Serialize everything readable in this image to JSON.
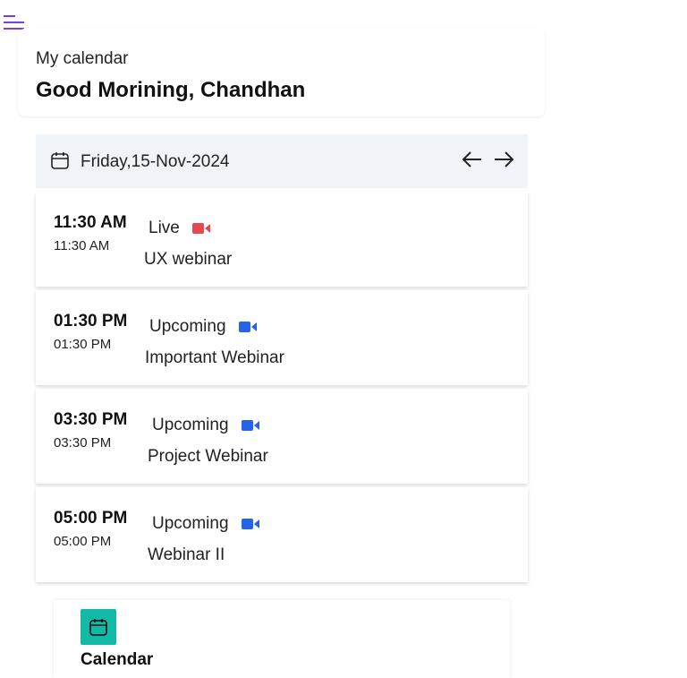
{
  "header": {
    "subtitle": "My calendar",
    "greeting": "Good Morining, Chandhan"
  },
  "schedule": {
    "date": "Friday,15-Nov-2024",
    "events": [
      {
        "time": "11:30 AM",
        "time_sub": "11:30 AM",
        "status": "Live",
        "title": "UX webinar",
        "video_color": "#e5484d"
      },
      {
        "time": "01:30 PM",
        "time_sub": "01:30 PM",
        "status": "Upcoming",
        "title": "Important Webinar",
        "video_color": "#2563eb"
      },
      {
        "time": "03:30 PM",
        "time_sub": "03:30 PM",
        "status": "Upcoming",
        "title": "Project Webinar",
        "video_color": "#2563eb"
      },
      {
        "time": "05:00 PM",
        "time_sub": "05:00 PM",
        "status": "Upcoming",
        "title": "Webinar II",
        "video_color": "#2563eb"
      }
    ]
  },
  "bottom_nav": {
    "label": "Calendar",
    "tile_color": "#14b8a6"
  },
  "colors": {
    "menu_icon": "#7c3aed",
    "date_bar_bg": "#f0f4f8"
  },
  "icons": {
    "menu": "menu-icon",
    "calendar": "calendar-icon",
    "prev": "arrow-left-icon",
    "next": "arrow-right-icon",
    "video": "video-camera-icon"
  }
}
